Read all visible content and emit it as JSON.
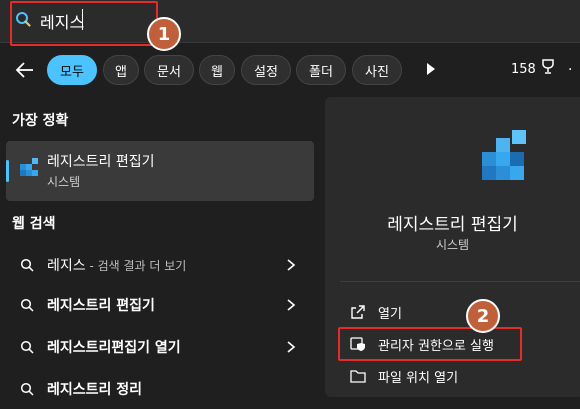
{
  "search": {
    "query": "레지스"
  },
  "badges": {
    "first": "1",
    "second": "2"
  },
  "filters": {
    "tabs": [
      "모두",
      "앱",
      "문서",
      "웹",
      "설정",
      "폴더",
      "사진"
    ],
    "points": "158"
  },
  "best_match": {
    "title": "가장 정확",
    "name": "레지스트리 편집기",
    "subtitle": "시스템"
  },
  "web_search": {
    "title": "웹 검색",
    "items": [
      {
        "bold": "레지스",
        "suffix": " - 검색 결과 더 보기"
      },
      {
        "bold": "레지스트리 편집기",
        "suffix": ""
      },
      {
        "bold": "레지스트리편집기 열기",
        "suffix": ""
      },
      {
        "bold": "레지스트리 정리",
        "suffix": ""
      }
    ]
  },
  "preview": {
    "name": "레지스트리 편집기",
    "subtitle": "시스템",
    "actions": [
      {
        "label": "열기",
        "icon": "open-external-icon"
      },
      {
        "label": "관리자 권한으로 실행",
        "icon": "shield-run-icon"
      },
      {
        "label": "파일 위치 열기",
        "icon": "folder-icon"
      }
    ]
  },
  "colors": {
    "accent": "#4cc2ff",
    "highlight": "#e62b2b",
    "badge": "#c0603b"
  }
}
